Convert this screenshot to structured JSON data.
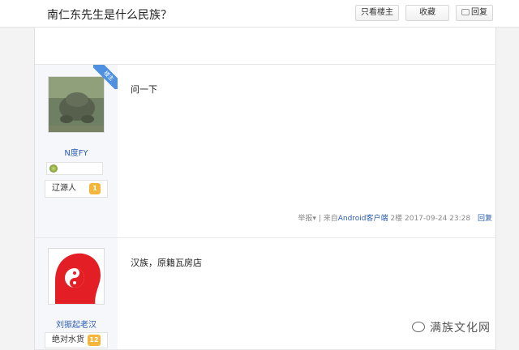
{
  "thread": {
    "title": "南仁东先生是什么民族？",
    "buttons": {
      "author_only": "只看楼主",
      "favorite": "收藏",
      "reply": "回复"
    }
  },
  "posts": [
    {
      "author": "N度FY",
      "rank_label": "辽源人",
      "level": "1",
      "op_ribbon": "楼主",
      "content": "问一下",
      "footer": {
        "report": "举报",
        "source_prefix": "| 来自",
        "source": "Android客户端",
        "floor": "2楼",
        "time": "2017-09-24 23:28",
        "reply": "回复"
      }
    },
    {
      "author": "刘振起老汉",
      "rank_label": "绝对水货",
      "level": "12",
      "content": "汉族，原籍瓦房店"
    }
  ],
  "watermark": "满族文化网",
  "colors": {
    "link": "#2a5db0",
    "ribbon": "#4d91e0",
    "level": "#f4b63a",
    "avatar_red": "#e31e24"
  }
}
